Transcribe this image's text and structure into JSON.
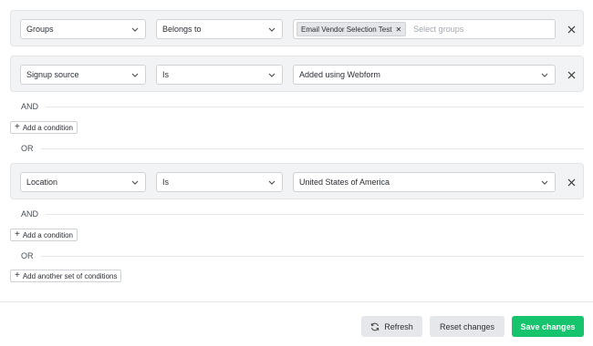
{
  "condition_sets": [
    {
      "rows": [
        {
          "field": "Groups",
          "operator": "Belongs to",
          "value_chips": [
            "Email Vendor Selection Test"
          ],
          "value_placeholder": "Select groups"
        }
      ]
    },
    {
      "rows": [
        {
          "field": "Signup source",
          "operator": "Is",
          "value": "Added using Webform"
        }
      ]
    },
    {
      "rows": [
        {
          "field": "Location",
          "operator": "Is",
          "value": "United States of America"
        }
      ]
    }
  ],
  "labels": {
    "and": "AND",
    "or": "OR",
    "add_condition": "Add a condition",
    "add_another_set": "Add another set of conditions"
  },
  "footer": {
    "refresh": "Refresh",
    "reset": "Reset changes",
    "save": "Save changes"
  },
  "icons": {
    "chevron": "chevron-down-icon",
    "remove": "close-icon",
    "refresh": "refresh-icon",
    "add": "plus-icon"
  },
  "colors": {
    "save_button": "#16c46d",
    "condition_background": "#f2f3f5"
  }
}
